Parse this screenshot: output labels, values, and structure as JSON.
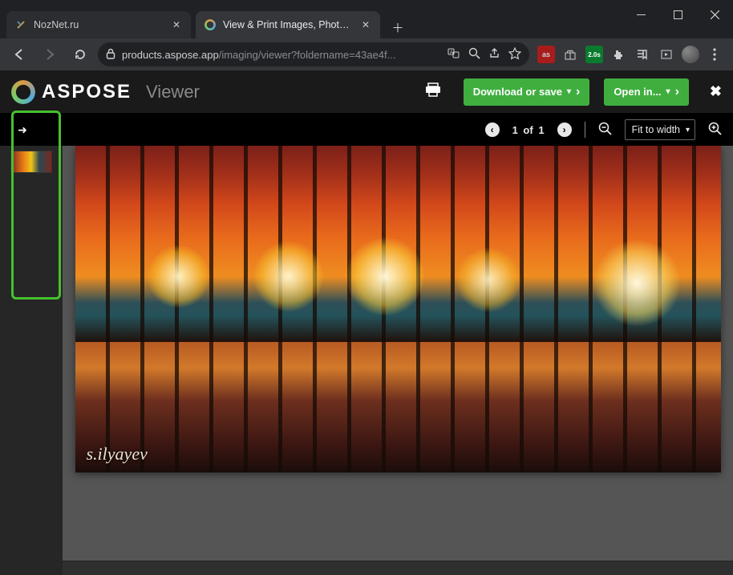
{
  "window": {
    "tabs": [
      {
        "title": "NozNet.ru",
        "active": false
      },
      {
        "title": "View & Print Images, Photos or P",
        "active": true
      }
    ]
  },
  "toolbar": {
    "url_host": "products.aspose.app",
    "url_path": "/imaging/viewer?foldername=43ae4f..."
  },
  "app": {
    "brand": "ASPOSE",
    "section": "Viewer",
    "download_label": "Download or save",
    "open_label": "Open in..."
  },
  "viewer": {
    "page_current": 1,
    "page_total": 1,
    "page_sep": "of",
    "zoom_mode": "Fit to width"
  },
  "image": {
    "signature": "s.ilyayev"
  }
}
